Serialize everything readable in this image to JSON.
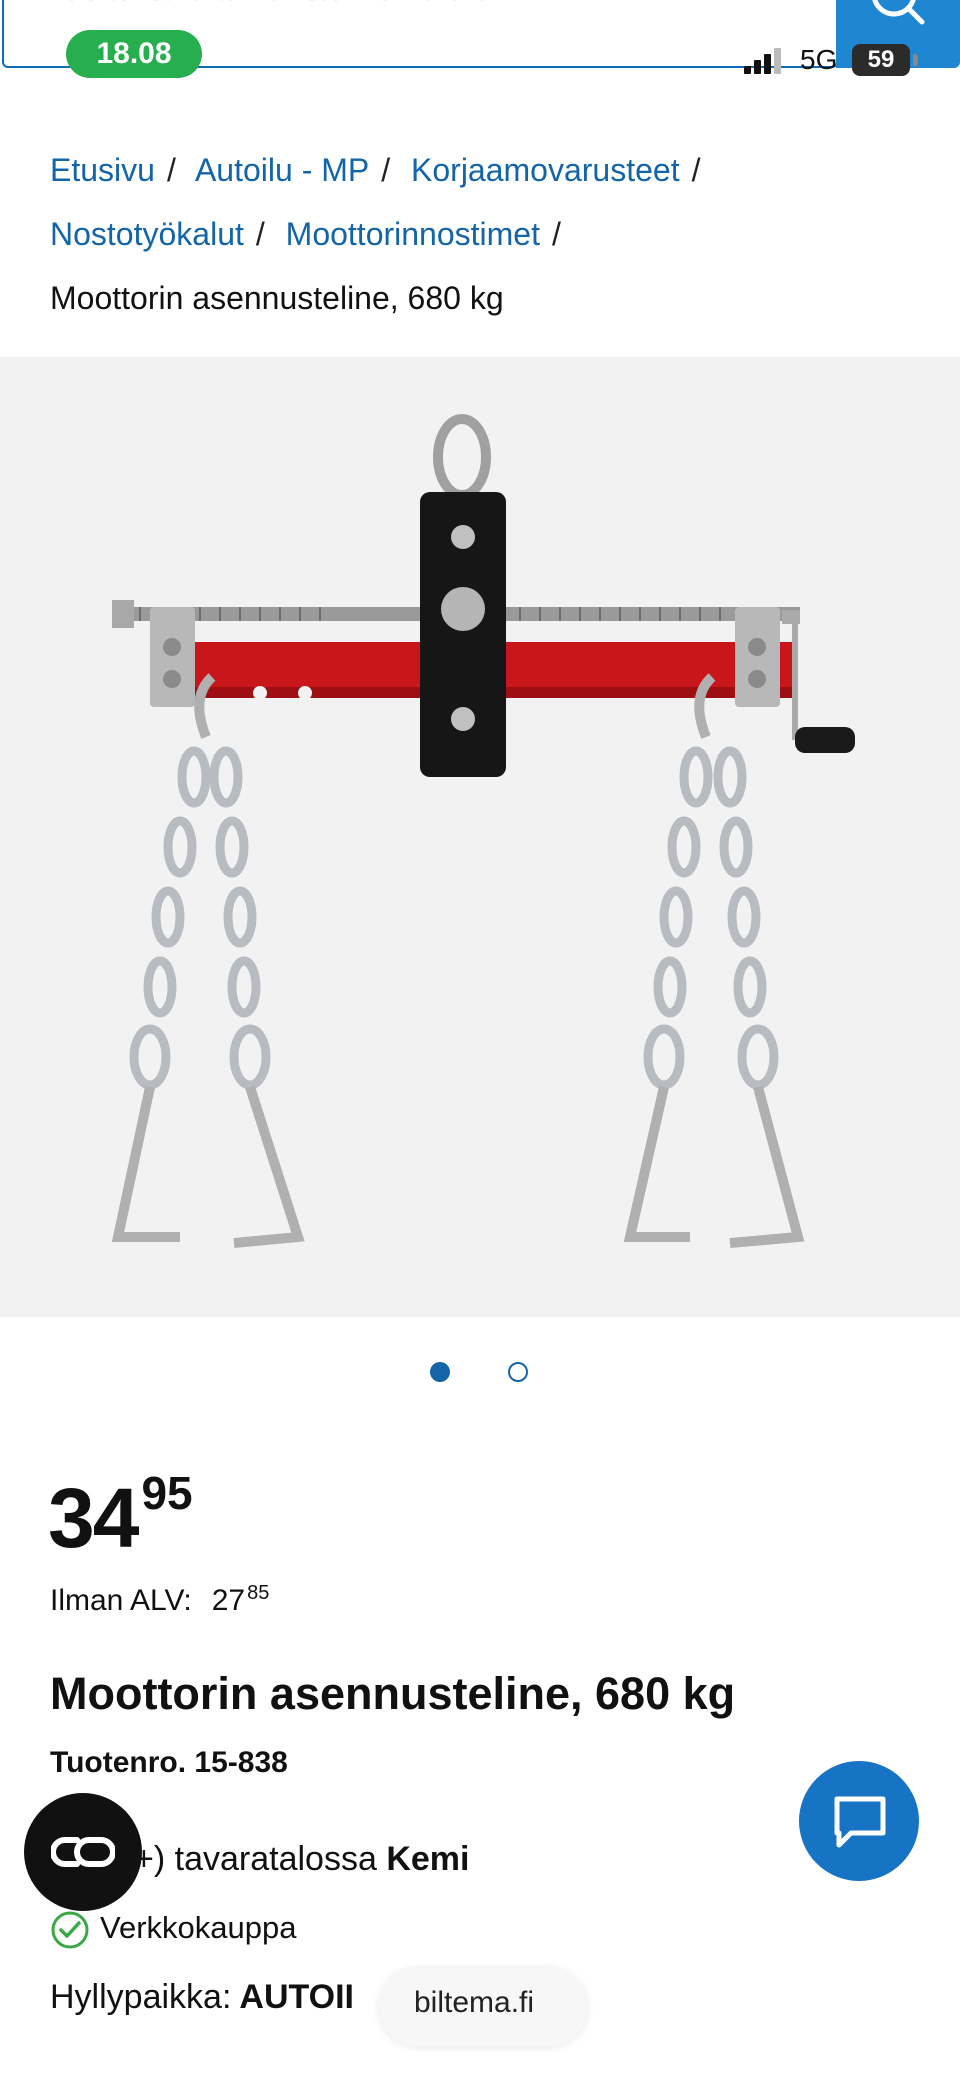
{
  "search": {
    "placeholder": "Hae tekstillä tai rekisterinumerolla."
  },
  "status_bar": {
    "time": "18.08",
    "network": "5G",
    "battery": "59"
  },
  "breadcrumb": {
    "items": [
      {
        "label": "Etusivu"
      },
      {
        "label": "Autoilu - MP"
      },
      {
        "label": "Korjaamovarusteet"
      },
      {
        "label": "Nostotyökalut"
      },
      {
        "label": "Moottorinnostimet"
      }
    ],
    "separator": "/",
    "current": "Moottorin asennusteline, 680 kg"
  },
  "carousel": {
    "count": 2,
    "active_index": 0
  },
  "price": {
    "integer": "34",
    "decimals": "95",
    "vat_label": "Ilman ALV:",
    "vat_integer": "27",
    "vat_decimals": "85"
  },
  "product": {
    "title": "Moottorin asennusteline, 680 kg",
    "number": "Tuotenro. 15-838"
  },
  "availability": {
    "store_prefix": "+) tavaratalossa",
    "store_name": "Kemi",
    "online": "Verkkokauppa",
    "shelf_label": "Hyllypaikka:",
    "shelf_value": "AUTOII"
  },
  "browser": {
    "url": "biltema.fi"
  },
  "colors": {
    "brand_blue": "#1464a8",
    "search_button": "#1f86d1",
    "time_pill": "#27ae4f",
    "chat_button": "#1773c3",
    "check_green": "#3aa845",
    "product_red": "#c9161b"
  },
  "icons": {
    "search": "search-icon",
    "chat": "chat-bubble-icon",
    "co": "co-link-icon",
    "check": "check-circle-icon"
  }
}
